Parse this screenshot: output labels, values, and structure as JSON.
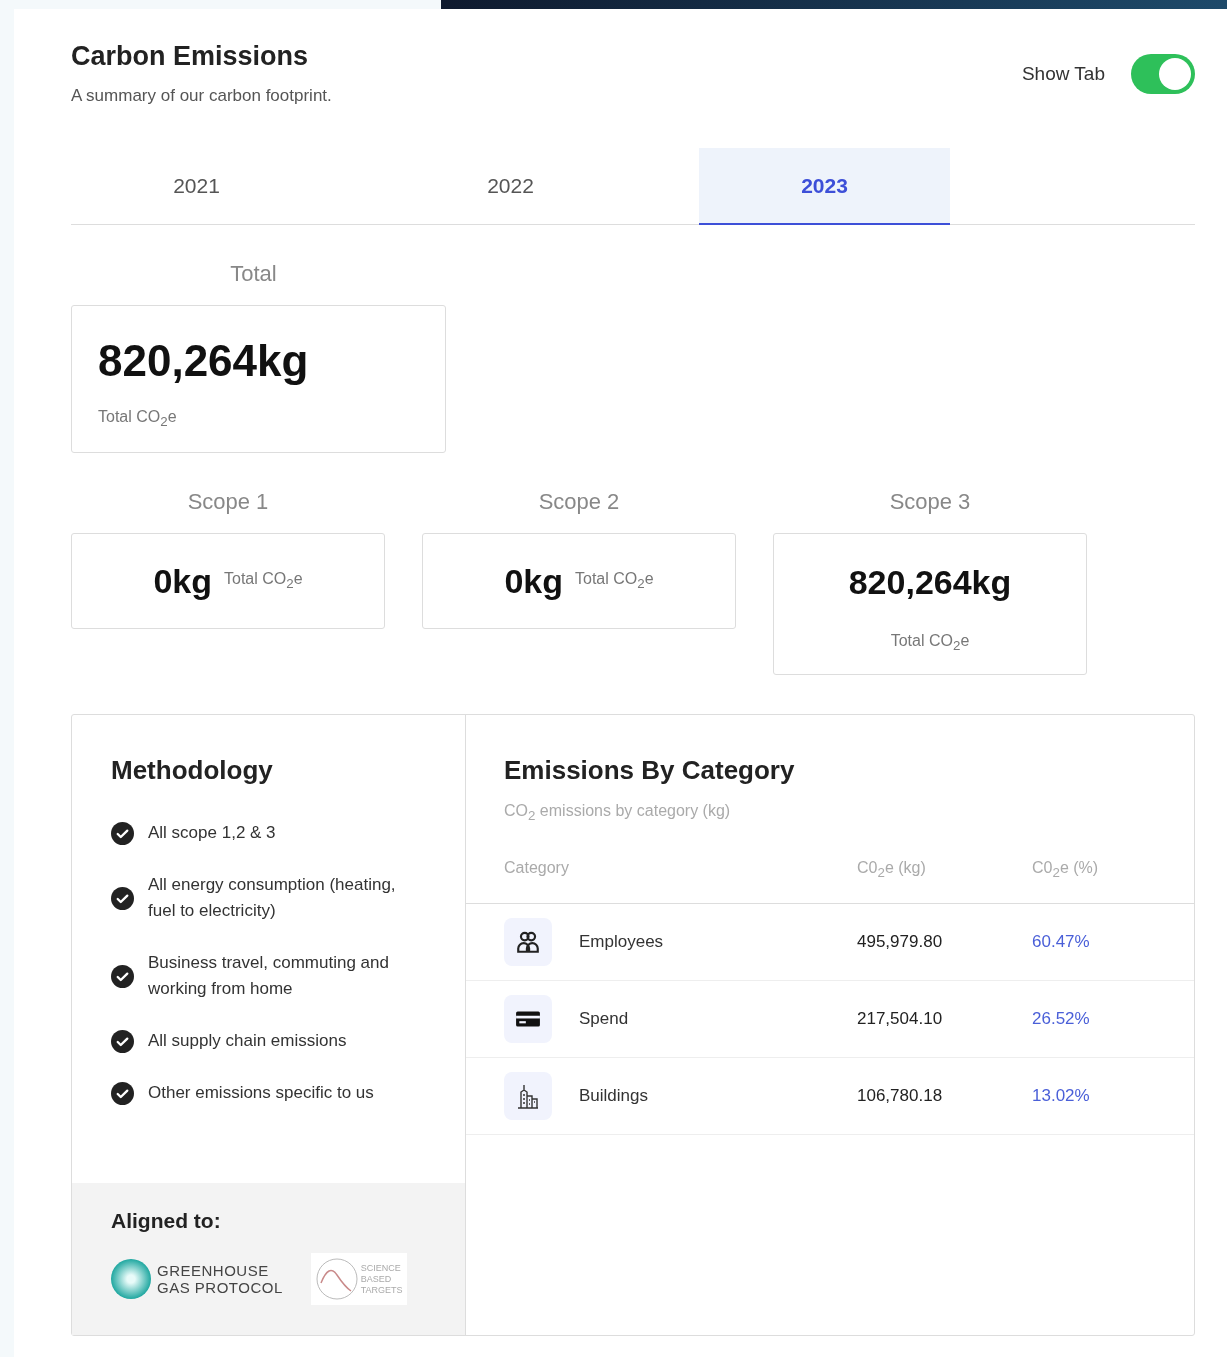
{
  "header": {
    "title": "Carbon Emissions",
    "subtitle": "A summary of our carbon footprint.",
    "toggle": {
      "label": "Show Tab",
      "on": true
    }
  },
  "tabs": [
    {
      "label": "2021",
      "selected": false
    },
    {
      "label": "2022",
      "selected": false
    },
    {
      "label": "2023",
      "selected": true
    }
  ],
  "total": {
    "label": "Total",
    "value": "820,264kg",
    "caption": "Total CO$_{2}$e"
  },
  "scopes": [
    {
      "label": "Scope 1",
      "value": "0kg",
      "caption": "Total CO$_{2}$e",
      "kind": "inline"
    },
    {
      "label": "Scope 2",
      "value": "0kg",
      "caption": "Total CO$_{2}$e",
      "kind": "inline"
    },
    {
      "label": "Scope 3",
      "value": "820,264kg",
      "caption": "Total CO$_{2}$e",
      "kind": "stacked"
    }
  ],
  "methodology": {
    "title": "Methodology",
    "items": [
      "All scope 1,2 & 3",
      "All energy consumption (heating, fuel to electricity)",
      "Business travel, commuting and working from home",
      "All supply chain emissions",
      "Other emissions specific to us"
    ],
    "aligned": {
      "title": "Aligned to:",
      "logos": [
        {
          "kind": "ghg",
          "lines": [
            "GREENHOUSE",
            "GAS PROTOCOL"
          ]
        },
        {
          "kind": "sbt",
          "lines": [
            "SCIENCE",
            "BASED",
            "TARGETS"
          ]
        }
      ]
    }
  },
  "categories": {
    "title": "Emissions By Category",
    "subtitle": "CO$_{2}$ emissions by category (kg)",
    "columns": [
      "Category",
      "C0$_{2}$e (kg)",
      "C0$_{2}$e (%)"
    ],
    "rows": [
      {
        "kind": "employees",
        "name": "Employees",
        "kg": "495,979.80",
        "pct": "60.47%"
      },
      {
        "kind": "spend",
        "name": "Spend",
        "kg": "217,504.10",
        "pct": "26.52%"
      },
      {
        "kind": "buildings",
        "name": "Buildings",
        "kg": "106,780.18",
        "pct": "13.02%"
      }
    ]
  }
}
